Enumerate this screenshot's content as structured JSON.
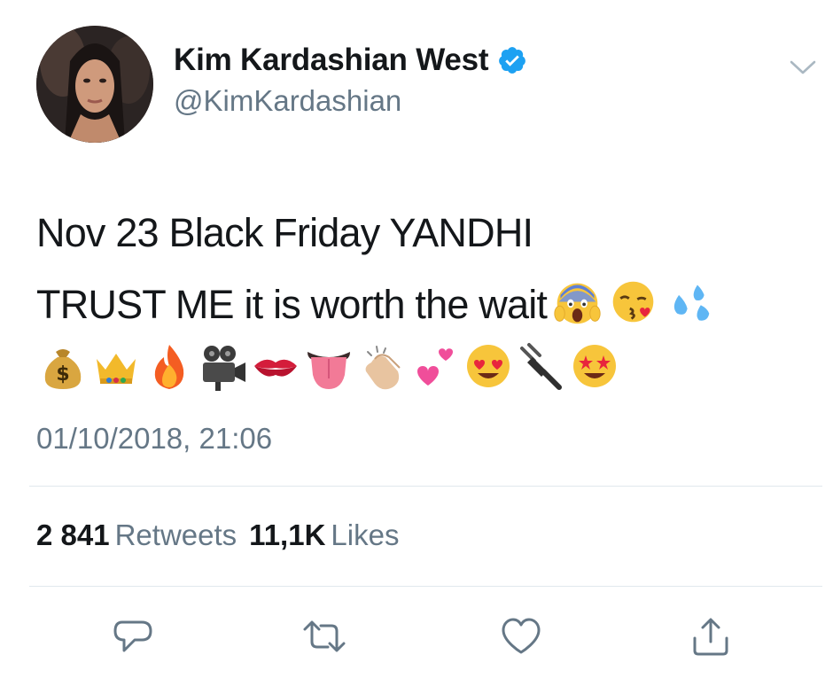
{
  "author": {
    "display_name": "Kim Kardashian West",
    "handle": "@KimKardashian",
    "verified": true,
    "verified_color": "#1da1f2"
  },
  "tweet": {
    "line1": "Nov 23 Black Friday YANDHI",
    "line2": "TRUST ME it is worth the wait",
    "line2_emojis": [
      "screaming-face",
      "face-blowing-kiss",
      "sweat-droplets"
    ],
    "line3_emojis": [
      "money-bag",
      "crown",
      "fire",
      "movie-camera",
      "kiss-mark",
      "tongue",
      "clapping-hands",
      "two-hearts",
      "heart-eyes-face",
      "electric-plug",
      "star-struck-face"
    ]
  },
  "timestamp": "01/10/2018, 21:06",
  "stats": {
    "retweets_count": "2 841",
    "retweets_label": "Retweets",
    "likes_count": "11,1K",
    "likes_label": "Likes"
  },
  "actions": [
    "reply-icon",
    "retweet-icon",
    "like-icon",
    "share-icon"
  ],
  "colors": {
    "text_primary": "#14171a",
    "text_secondary": "#657786",
    "divider": "#e1e8ed",
    "icon": "#657786"
  }
}
